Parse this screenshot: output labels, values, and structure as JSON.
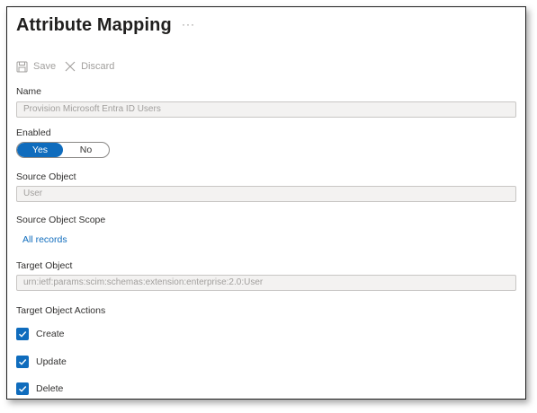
{
  "header": {
    "title": "Attribute Mapping",
    "more": "···"
  },
  "toolbar": {
    "save_label": "Save",
    "discard_label": "Discard"
  },
  "name": {
    "label": "Name",
    "value": "Provision Microsoft Entra ID Users"
  },
  "enabled": {
    "label": "Enabled",
    "yes": "Yes",
    "no": "No",
    "selected": "Yes"
  },
  "source_object": {
    "label": "Source Object",
    "value": "User"
  },
  "source_scope": {
    "label": "Source Object Scope",
    "link": "All records"
  },
  "target_object": {
    "label": "Target Object",
    "value": "urn:ietf:params:scim:schemas:extension:enterprise:2.0:User"
  },
  "target_actions": {
    "label": "Target Object Actions",
    "items": [
      {
        "label": "Create",
        "checked": true
      },
      {
        "label": "Update",
        "checked": true
      },
      {
        "label": "Delete",
        "checked": true
      }
    ]
  },
  "colors": {
    "accent": "#0f6cbd",
    "disabled_field": "#f3f2f1"
  }
}
